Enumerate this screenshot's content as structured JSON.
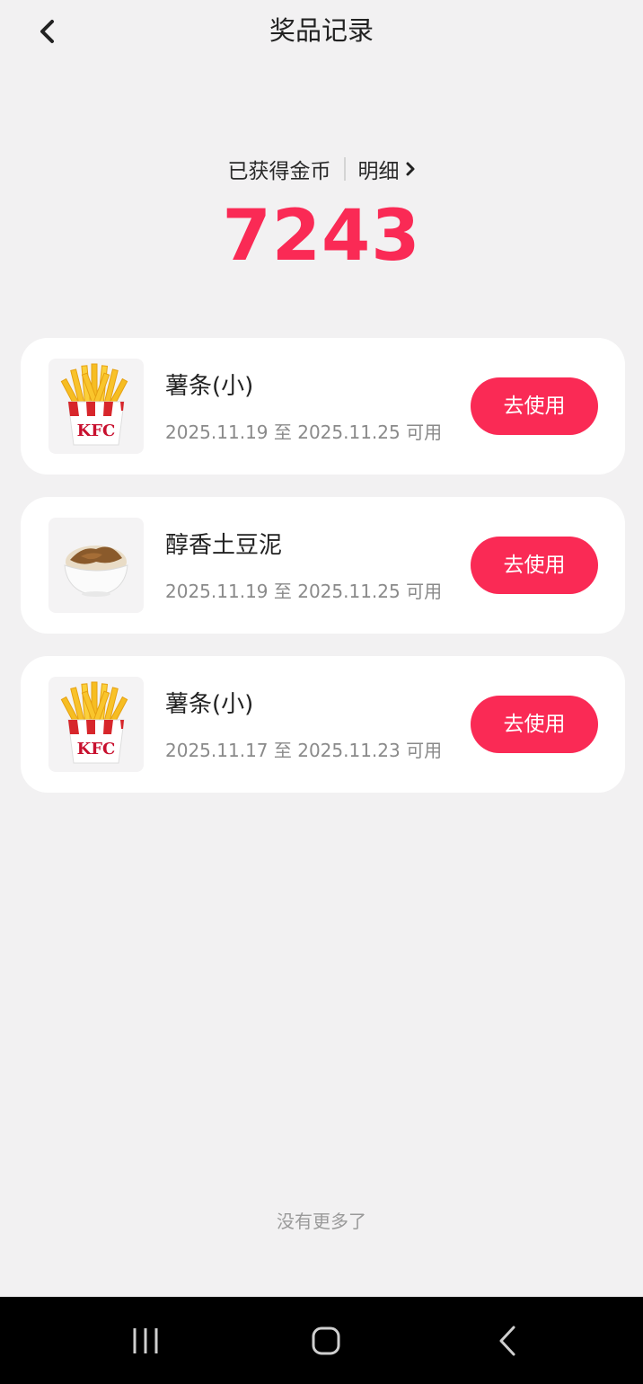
{
  "header": {
    "title": "奖品记录",
    "back_icon": "back-arrow-icon"
  },
  "coins": {
    "label": "已获得金币",
    "details_label": "明细",
    "value": "7243",
    "accent_color": "#fa2a55"
  },
  "prizes": [
    {
      "name": "薯条(小)",
      "validity": "2025.11.19 至 2025.11.25 可用",
      "button_label": "去使用",
      "image": "kfc-fries-image"
    },
    {
      "name": "醇香土豆泥",
      "validity": "2025.11.19 至 2025.11.25 可用",
      "button_label": "去使用",
      "image": "mashed-potato-image"
    },
    {
      "name": "薯条(小)",
      "validity": "2025.11.17 至 2025.11.23 可用",
      "button_label": "去使用",
      "image": "kfc-fries-image"
    }
  ],
  "footer": {
    "end_note": "没有更多了"
  },
  "system_nav": {
    "recents_icon": "recents-icon",
    "home_icon": "home-icon",
    "back_icon": "back-icon"
  }
}
